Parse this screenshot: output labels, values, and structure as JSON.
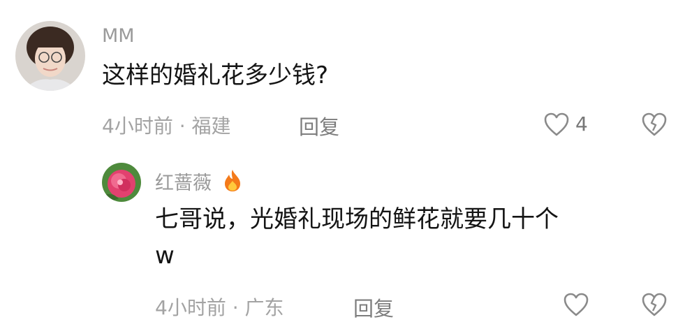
{
  "comments": [
    {
      "username": "MM",
      "text": "这样的婚礼花多少钱?",
      "meta": "4小时前 · 福建",
      "reply_label": "回复",
      "like_count": "4"
    },
    {
      "username": "红蔷薇",
      "text_line1": "七哥说，光婚礼现场的鲜花就要几十个",
      "text_line2": "w",
      "meta": "4小时前 · 广东",
      "reply_label": "回复"
    }
  ],
  "icons": {
    "like": "heart-outline-icon",
    "dislike": "broken-heart-icon",
    "badge": "fire-icon"
  },
  "colors": {
    "username": "#9a9a9a",
    "meta": "#a3a3a3",
    "fire": "#f47a1a"
  }
}
